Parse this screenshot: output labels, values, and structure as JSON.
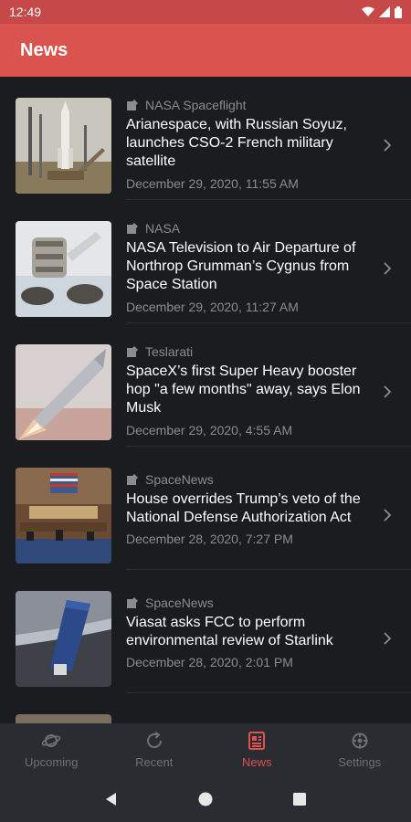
{
  "status_bar": {
    "time": "12:49"
  },
  "app_bar": {
    "title": "News"
  },
  "articles": [
    {
      "source": "NASA Spaceflight",
      "title": "Arianespace, with Russian Soyuz, launches CSO-2 French military satellite",
      "date": "December 29, 2020, 11:55 AM",
      "thumbnail": "soyuz-launch-pad-image"
    },
    {
      "source": "NASA",
      "title": "NASA Television to Air Departure of Northrop Grumman’s Cygnus from Space Station",
      "date": "December 29, 2020, 11:27 AM",
      "thumbnail": "cygnus-robotic-arm-image"
    },
    {
      "source": "Teslarati",
      "title": "SpaceX’s first Super Heavy booster hop \"a few months\" away, says Elon Musk",
      "date": "December 29, 2020, 4:55 AM",
      "thumbnail": "starship-render-image"
    },
    {
      "source": "SpaceNews",
      "title": "House overrides Trump’s veto of the National Defense Authorization Act",
      "date": "December 28, 2020, 7:27 PM",
      "thumbnail": "house-chamber-image"
    },
    {
      "source": "SpaceNews",
      "title": "Viasat asks FCC to perform environmental review of Starlink",
      "date": "December 28, 2020, 2:01 PM",
      "thumbnail": "starlink-satellite-image"
    }
  ],
  "bottom_nav": {
    "items": [
      {
        "label": "Upcoming",
        "icon": "planet-icon",
        "active": false
      },
      {
        "label": "Recent",
        "icon": "history-icon",
        "active": false
      },
      {
        "label": "News",
        "icon": "newspaper-icon",
        "active": true
      },
      {
        "label": "Settings",
        "icon": "gear-icon",
        "active": false
      }
    ]
  },
  "colors": {
    "accent": "#d9534f",
    "status_bar": "#c64848",
    "background": "#1b1c20",
    "muted_text": "#8b8c90",
    "nav_background": "#2a2c31"
  }
}
